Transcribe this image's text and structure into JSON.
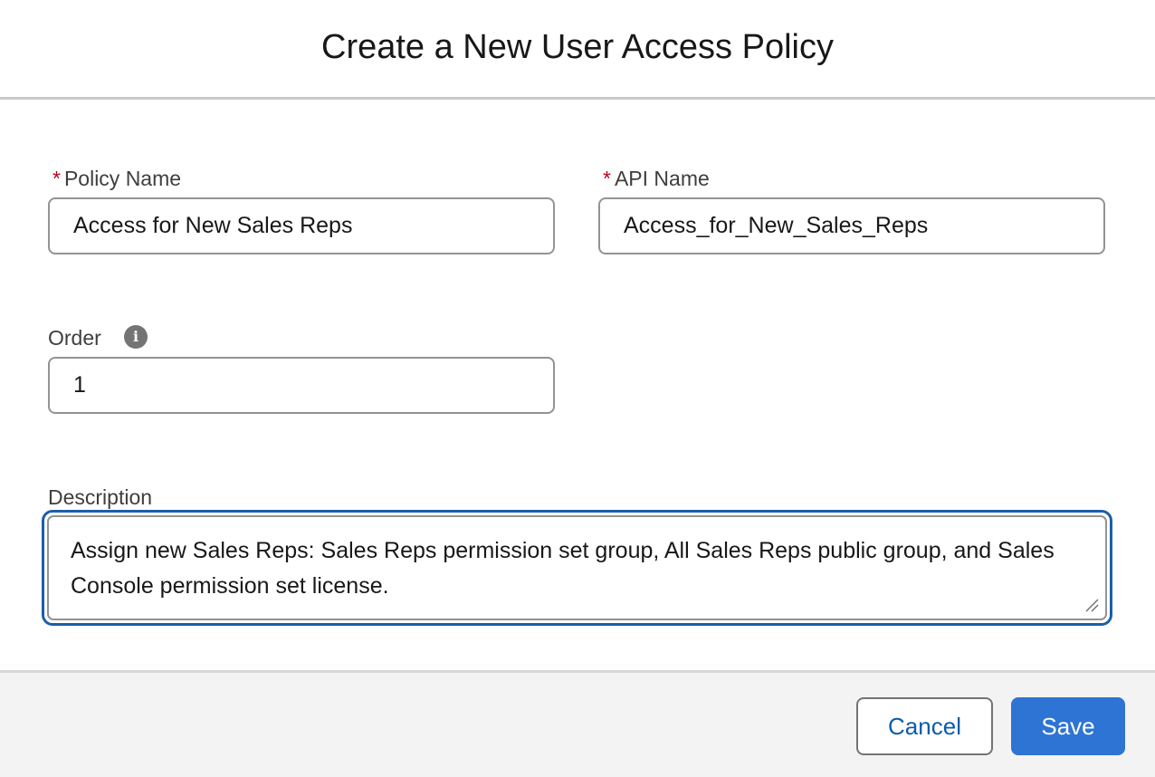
{
  "modal": {
    "title": "Create a New User Access Policy"
  },
  "form": {
    "required_marker": "*",
    "policy_name": {
      "label": "Policy Name",
      "value": "Access for New Sales Reps"
    },
    "api_name": {
      "label": "API Name",
      "value": "Access_for_New_Sales_Reps"
    },
    "order": {
      "label": "Order",
      "value": "1",
      "info_icon": "info-icon",
      "info_glyph": "i"
    },
    "description": {
      "label": "Description",
      "value": "Assign new Sales Reps: Sales Reps permission set group, All Sales Reps public group, and Sales Console permission set license."
    }
  },
  "footer": {
    "cancel_label": "Cancel",
    "save_label": "Save"
  },
  "colors": {
    "brand": "#2e74d4",
    "focus_ring": "#1b5fa8",
    "required": "#ba0517",
    "link_text": "#0b5cab"
  }
}
